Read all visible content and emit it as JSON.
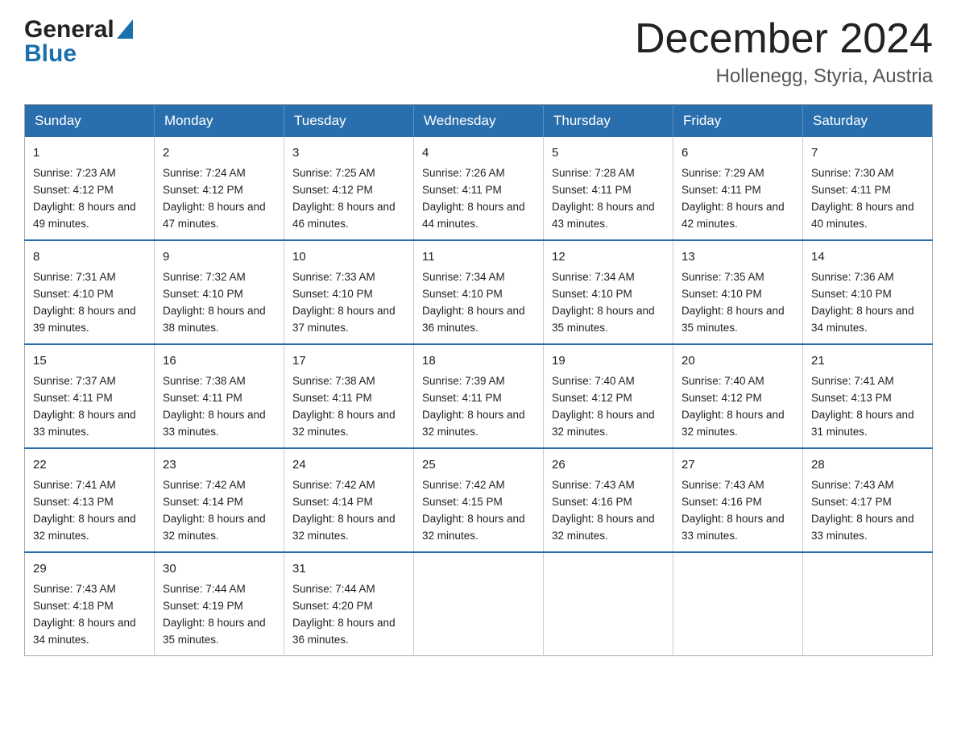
{
  "logo": {
    "general": "General",
    "blue": "Blue",
    "triangle": "▲"
  },
  "header": {
    "month": "December 2024",
    "location": "Hollenegg, Styria, Austria"
  },
  "days_of_week": [
    "Sunday",
    "Monday",
    "Tuesday",
    "Wednesday",
    "Thursday",
    "Friday",
    "Saturday"
  ],
  "weeks": [
    [
      {
        "day": "1",
        "sunrise": "7:23 AM",
        "sunset": "4:12 PM",
        "daylight": "8 hours and 49 minutes."
      },
      {
        "day": "2",
        "sunrise": "7:24 AM",
        "sunset": "4:12 PM",
        "daylight": "8 hours and 47 minutes."
      },
      {
        "day": "3",
        "sunrise": "7:25 AM",
        "sunset": "4:12 PM",
        "daylight": "8 hours and 46 minutes."
      },
      {
        "day": "4",
        "sunrise": "7:26 AM",
        "sunset": "4:11 PM",
        "daylight": "8 hours and 44 minutes."
      },
      {
        "day": "5",
        "sunrise": "7:28 AM",
        "sunset": "4:11 PM",
        "daylight": "8 hours and 43 minutes."
      },
      {
        "day": "6",
        "sunrise": "7:29 AM",
        "sunset": "4:11 PM",
        "daylight": "8 hours and 42 minutes."
      },
      {
        "day": "7",
        "sunrise": "7:30 AM",
        "sunset": "4:11 PM",
        "daylight": "8 hours and 40 minutes."
      }
    ],
    [
      {
        "day": "8",
        "sunrise": "7:31 AM",
        "sunset": "4:10 PM",
        "daylight": "8 hours and 39 minutes."
      },
      {
        "day": "9",
        "sunrise": "7:32 AM",
        "sunset": "4:10 PM",
        "daylight": "8 hours and 38 minutes."
      },
      {
        "day": "10",
        "sunrise": "7:33 AM",
        "sunset": "4:10 PM",
        "daylight": "8 hours and 37 minutes."
      },
      {
        "day": "11",
        "sunrise": "7:34 AM",
        "sunset": "4:10 PM",
        "daylight": "8 hours and 36 minutes."
      },
      {
        "day": "12",
        "sunrise": "7:34 AM",
        "sunset": "4:10 PM",
        "daylight": "8 hours and 35 minutes."
      },
      {
        "day": "13",
        "sunrise": "7:35 AM",
        "sunset": "4:10 PM",
        "daylight": "8 hours and 35 minutes."
      },
      {
        "day": "14",
        "sunrise": "7:36 AM",
        "sunset": "4:10 PM",
        "daylight": "8 hours and 34 minutes."
      }
    ],
    [
      {
        "day": "15",
        "sunrise": "7:37 AM",
        "sunset": "4:11 PM",
        "daylight": "8 hours and 33 minutes."
      },
      {
        "day": "16",
        "sunrise": "7:38 AM",
        "sunset": "4:11 PM",
        "daylight": "8 hours and 33 minutes."
      },
      {
        "day": "17",
        "sunrise": "7:38 AM",
        "sunset": "4:11 PM",
        "daylight": "8 hours and 32 minutes."
      },
      {
        "day": "18",
        "sunrise": "7:39 AM",
        "sunset": "4:11 PM",
        "daylight": "8 hours and 32 minutes."
      },
      {
        "day": "19",
        "sunrise": "7:40 AM",
        "sunset": "4:12 PM",
        "daylight": "8 hours and 32 minutes."
      },
      {
        "day": "20",
        "sunrise": "7:40 AM",
        "sunset": "4:12 PM",
        "daylight": "8 hours and 32 minutes."
      },
      {
        "day": "21",
        "sunrise": "7:41 AM",
        "sunset": "4:13 PM",
        "daylight": "8 hours and 31 minutes."
      }
    ],
    [
      {
        "day": "22",
        "sunrise": "7:41 AM",
        "sunset": "4:13 PM",
        "daylight": "8 hours and 32 minutes."
      },
      {
        "day": "23",
        "sunrise": "7:42 AM",
        "sunset": "4:14 PM",
        "daylight": "8 hours and 32 minutes."
      },
      {
        "day": "24",
        "sunrise": "7:42 AM",
        "sunset": "4:14 PM",
        "daylight": "8 hours and 32 minutes."
      },
      {
        "day": "25",
        "sunrise": "7:42 AM",
        "sunset": "4:15 PM",
        "daylight": "8 hours and 32 minutes."
      },
      {
        "day": "26",
        "sunrise": "7:43 AM",
        "sunset": "4:16 PM",
        "daylight": "8 hours and 32 minutes."
      },
      {
        "day": "27",
        "sunrise": "7:43 AM",
        "sunset": "4:16 PM",
        "daylight": "8 hours and 33 minutes."
      },
      {
        "day": "28",
        "sunrise": "7:43 AM",
        "sunset": "4:17 PM",
        "daylight": "8 hours and 33 minutes."
      }
    ],
    [
      {
        "day": "29",
        "sunrise": "7:43 AM",
        "sunset": "4:18 PM",
        "daylight": "8 hours and 34 minutes."
      },
      {
        "day": "30",
        "sunrise": "7:44 AM",
        "sunset": "4:19 PM",
        "daylight": "8 hours and 35 minutes."
      },
      {
        "day": "31",
        "sunrise": "7:44 AM",
        "sunset": "4:20 PM",
        "daylight": "8 hours and 36 minutes."
      },
      null,
      null,
      null,
      null
    ]
  ]
}
